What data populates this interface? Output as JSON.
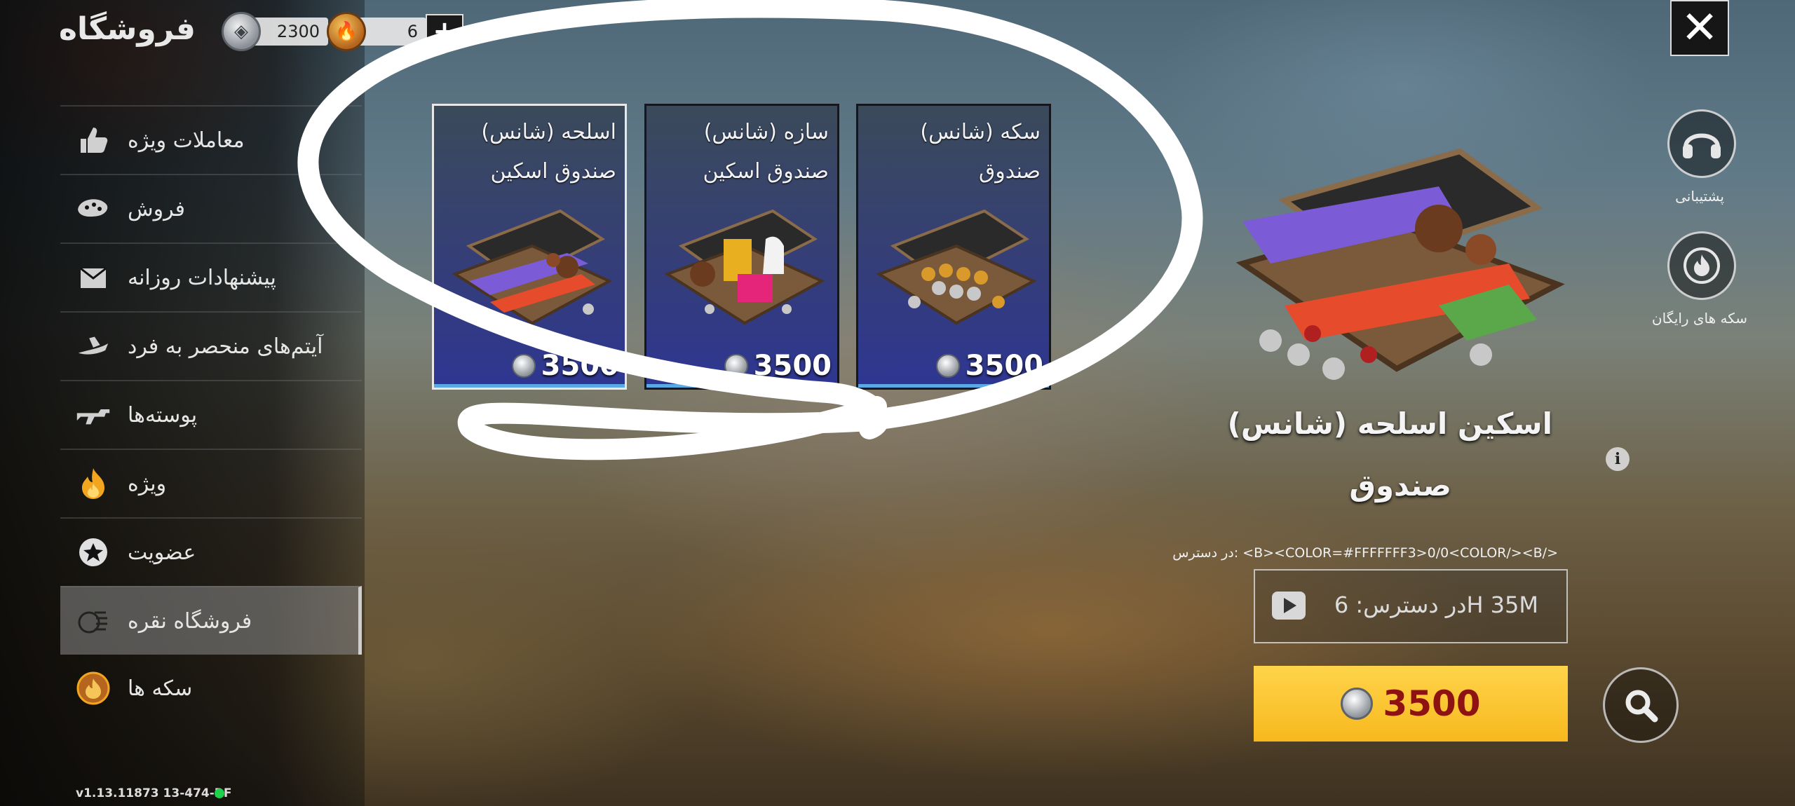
{
  "header": {
    "title": "فروشگاه",
    "silver_amount": "2300",
    "gold_amount": "6",
    "add_label": "+"
  },
  "sidebar": {
    "items": [
      {
        "label": "معاملات ویژه",
        "icon": "thumbs-up-icon"
      },
      {
        "label": "فروش",
        "icon": "sale-tag-icon"
      },
      {
        "label": "پیشنهادات روزانه",
        "icon": "envelope-icon"
      },
      {
        "label": "آیتم‌های منحصر به فرد",
        "icon": "hoverboard-icon"
      },
      {
        "label": "پوسته‌ها",
        "icon": "rifle-icon"
      },
      {
        "label": "ویژه",
        "icon": "premium-flame-icon"
      },
      {
        "label": "عضویت",
        "icon": "membership-star-icon"
      },
      {
        "label": "فروشگاه نقره",
        "icon": "silver-coins-icon",
        "active": true
      },
      {
        "label": "سکه ها",
        "icon": "gold-coin-icon"
      }
    ],
    "version": "v1.13.11873 13-474-RF"
  },
  "cards": [
    {
      "title_line1": "اسلحه (شانس)",
      "title_line2": "صندوق اسکین",
      "price": "3500",
      "selected": true
    },
    {
      "title_line1": "سازه (شانس)",
      "title_line2": "صندوق اسکین",
      "price": "3500",
      "selected": false
    },
    {
      "title_line1": "سکه (شانس)",
      "title_line2": "صندوق",
      "price": "3500",
      "selected": false
    }
  ],
  "right_panel": {
    "close_label": "✕",
    "support_label": "پشتیبانی",
    "free_coins_label": "سکه های رایگان",
    "detail_title_line1": "اسکین اسلحه (شانس)",
    "detail_title_line2": "صندوق",
    "availability_raw": "در دسترس: <B><COLOR=#FFFFFFF3>0/0<COLOR/><B/>",
    "video_text": "در دسترس: 6H 35M",
    "buy_price": "3500"
  },
  "colors": {
    "buy_button": "#f7b81e",
    "price_text": "#8f1212",
    "card_bottom_bar": "#5aa9e6",
    "online_indicator": "#1fd04a",
    "annotation_circle": "#ffffff"
  }
}
